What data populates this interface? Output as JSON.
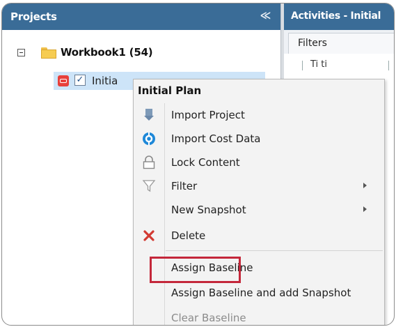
{
  "projects_panel": {
    "title": "Projects",
    "collapse_glyph": "≪"
  },
  "activities_panel": {
    "title": "Activities - Initial",
    "filters_tab": "Filters",
    "grid_partial_text": "Ti   ti"
  },
  "tree": {
    "workbook_label": "Workbook1 (54)",
    "child_label": "Initia",
    "child_checked": true
  },
  "context_menu": {
    "title": "Initial  Plan",
    "items": [
      {
        "label": "Import Project",
        "icon": "import-project-icon",
        "submenu": false,
        "disabled": false
      },
      {
        "label": "Import Cost Data",
        "icon": "import-cost-icon",
        "submenu": false,
        "disabled": false
      },
      {
        "label": "Lock Content",
        "icon": "lock-icon",
        "submenu": false,
        "disabled": false
      },
      {
        "label": "Filter",
        "icon": "filter-icon",
        "submenu": true,
        "disabled": false
      },
      {
        "label": "New Snapshot",
        "icon": "",
        "submenu": true,
        "disabled": false
      },
      {
        "label": "Delete",
        "icon": "delete-icon",
        "submenu": false,
        "disabled": false
      },
      {
        "label": "Assign Baseline",
        "icon": "",
        "submenu": false,
        "disabled": false
      },
      {
        "label": "Assign Baseline and add Snapshot",
        "icon": "",
        "submenu": false,
        "disabled": false
      },
      {
        "label": "Clear Baseline",
        "icon": "",
        "submenu": false,
        "disabled": true
      }
    ]
  },
  "colors": {
    "header_blue": "#3a6c97",
    "selection_blue": "#cde4f8",
    "highlight_red": "#c4273a"
  }
}
